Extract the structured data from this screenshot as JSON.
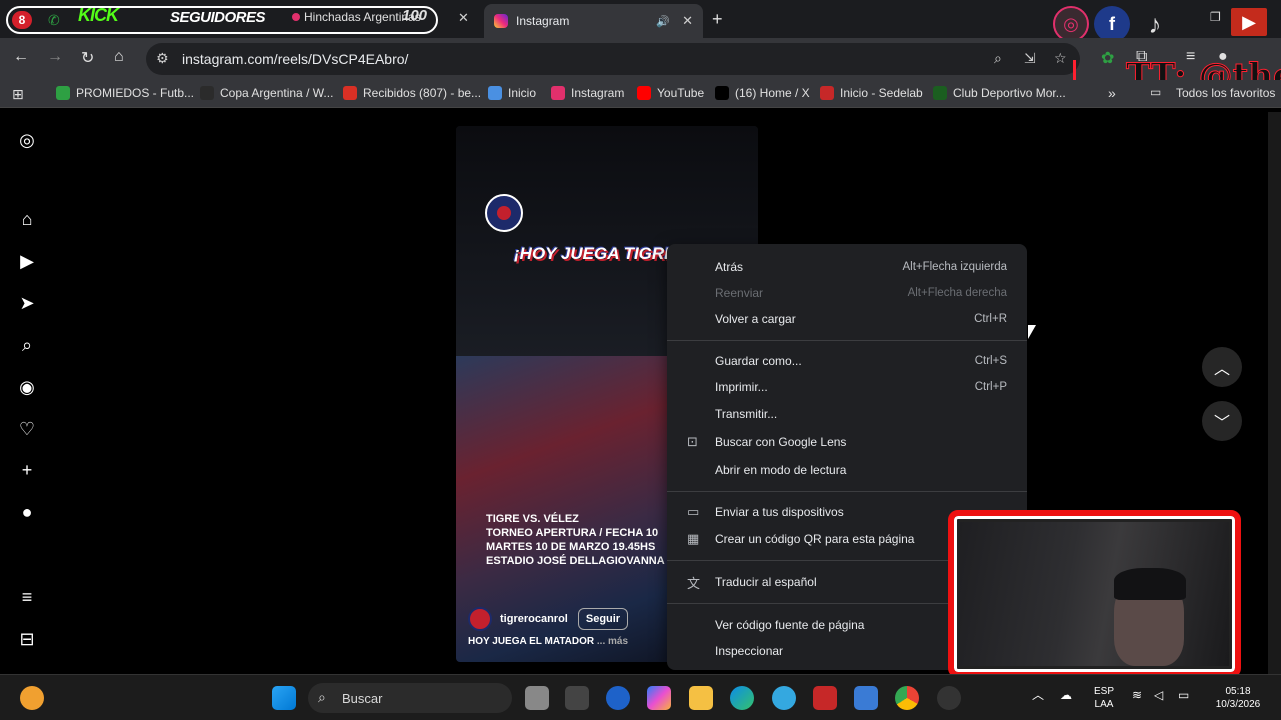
{
  "tabs": {
    "badge_count": "8",
    "kick": "KICK",
    "seguidores": "SEGUIDORES",
    "hinchadas_title": "Hinchadas Argentinas",
    "hinchadas_num": "100",
    "active_title": "Instagram"
  },
  "toolbar": {
    "url": "instagram.com/reels/DVsCP4EAbro/"
  },
  "overlay_text": "TT: @thel",
  "bookmarks": [
    {
      "label": "PROMIEDOS - Futb...",
      "color": "#2ea043"
    },
    {
      "label": "Copa Argentina / W...",
      "color": "#2b2b2b"
    },
    {
      "label": "Recibidos (807) - be...",
      "color": "#d93025"
    },
    {
      "label": "Inicio",
      "color": "#4a90e2"
    },
    {
      "label": "Instagram",
      "color": "#e1306c"
    },
    {
      "label": "YouTube",
      "color": "#ff0000"
    },
    {
      "label": "(16) Home / X",
      "color": "#000000"
    },
    {
      "label": "Inicio - Sedelab",
      "color": "#c62828"
    },
    {
      "label": "Club Deportivo Mor...",
      "color": "#1b5e20"
    }
  ],
  "all_bookmarks": "Todos los favoritos",
  "reel": {
    "headline": "¡HOY JUEGA TIGRE!",
    "info_lines": [
      "TIGRE VS. VÉLEZ",
      "TORNEO APERTURA / FECHA 10",
      "MARTES 10 DE MARZO 19.45HS",
      "ESTADIO JOSÉ DELLAGIOVANNA"
    ],
    "username": "tigrerocanrol",
    "follow": "Seguir",
    "caption": "HOY JUEGA EL MATADOR",
    "more": "... más"
  },
  "context_menu": [
    {
      "label": "Atrás",
      "shortcut": "Alt+Flecha izquierda",
      "disabled": false
    },
    {
      "label": "Reenviar",
      "shortcut": "Alt+Flecha derecha",
      "disabled": true
    },
    {
      "label": "Volver a cargar",
      "shortcut": "Ctrl+R",
      "disabled": false
    },
    {
      "label": "Guardar como...",
      "shortcut": "Ctrl+S",
      "disabled": false
    },
    {
      "label": "Imprimir...",
      "shortcut": "Ctrl+P",
      "disabled": false
    },
    {
      "label": "Transmitir...",
      "shortcut": "",
      "disabled": false
    },
    {
      "label": "Buscar con Google Lens",
      "shortcut": "",
      "disabled": false
    },
    {
      "label": "Abrir en modo de lectura",
      "shortcut": "",
      "disabled": false
    },
    {
      "label": "Enviar a tus dispositivos",
      "shortcut": "",
      "disabled": false
    },
    {
      "label": "Crear un código QR para esta página",
      "shortcut": "",
      "disabled": false
    },
    {
      "label": "Traducir al español",
      "shortcut": "",
      "disabled": false
    },
    {
      "label": "Ver código fuente de página",
      "shortcut": "",
      "disabled": false
    },
    {
      "label": "Inspeccionar",
      "shortcut": "",
      "disabled": false
    }
  ],
  "taskbar": {
    "search_placeholder": "Buscar",
    "lang_top": "ESP",
    "lang_bottom": "LAA",
    "time": "05:18",
    "date": "10/3/2026"
  }
}
